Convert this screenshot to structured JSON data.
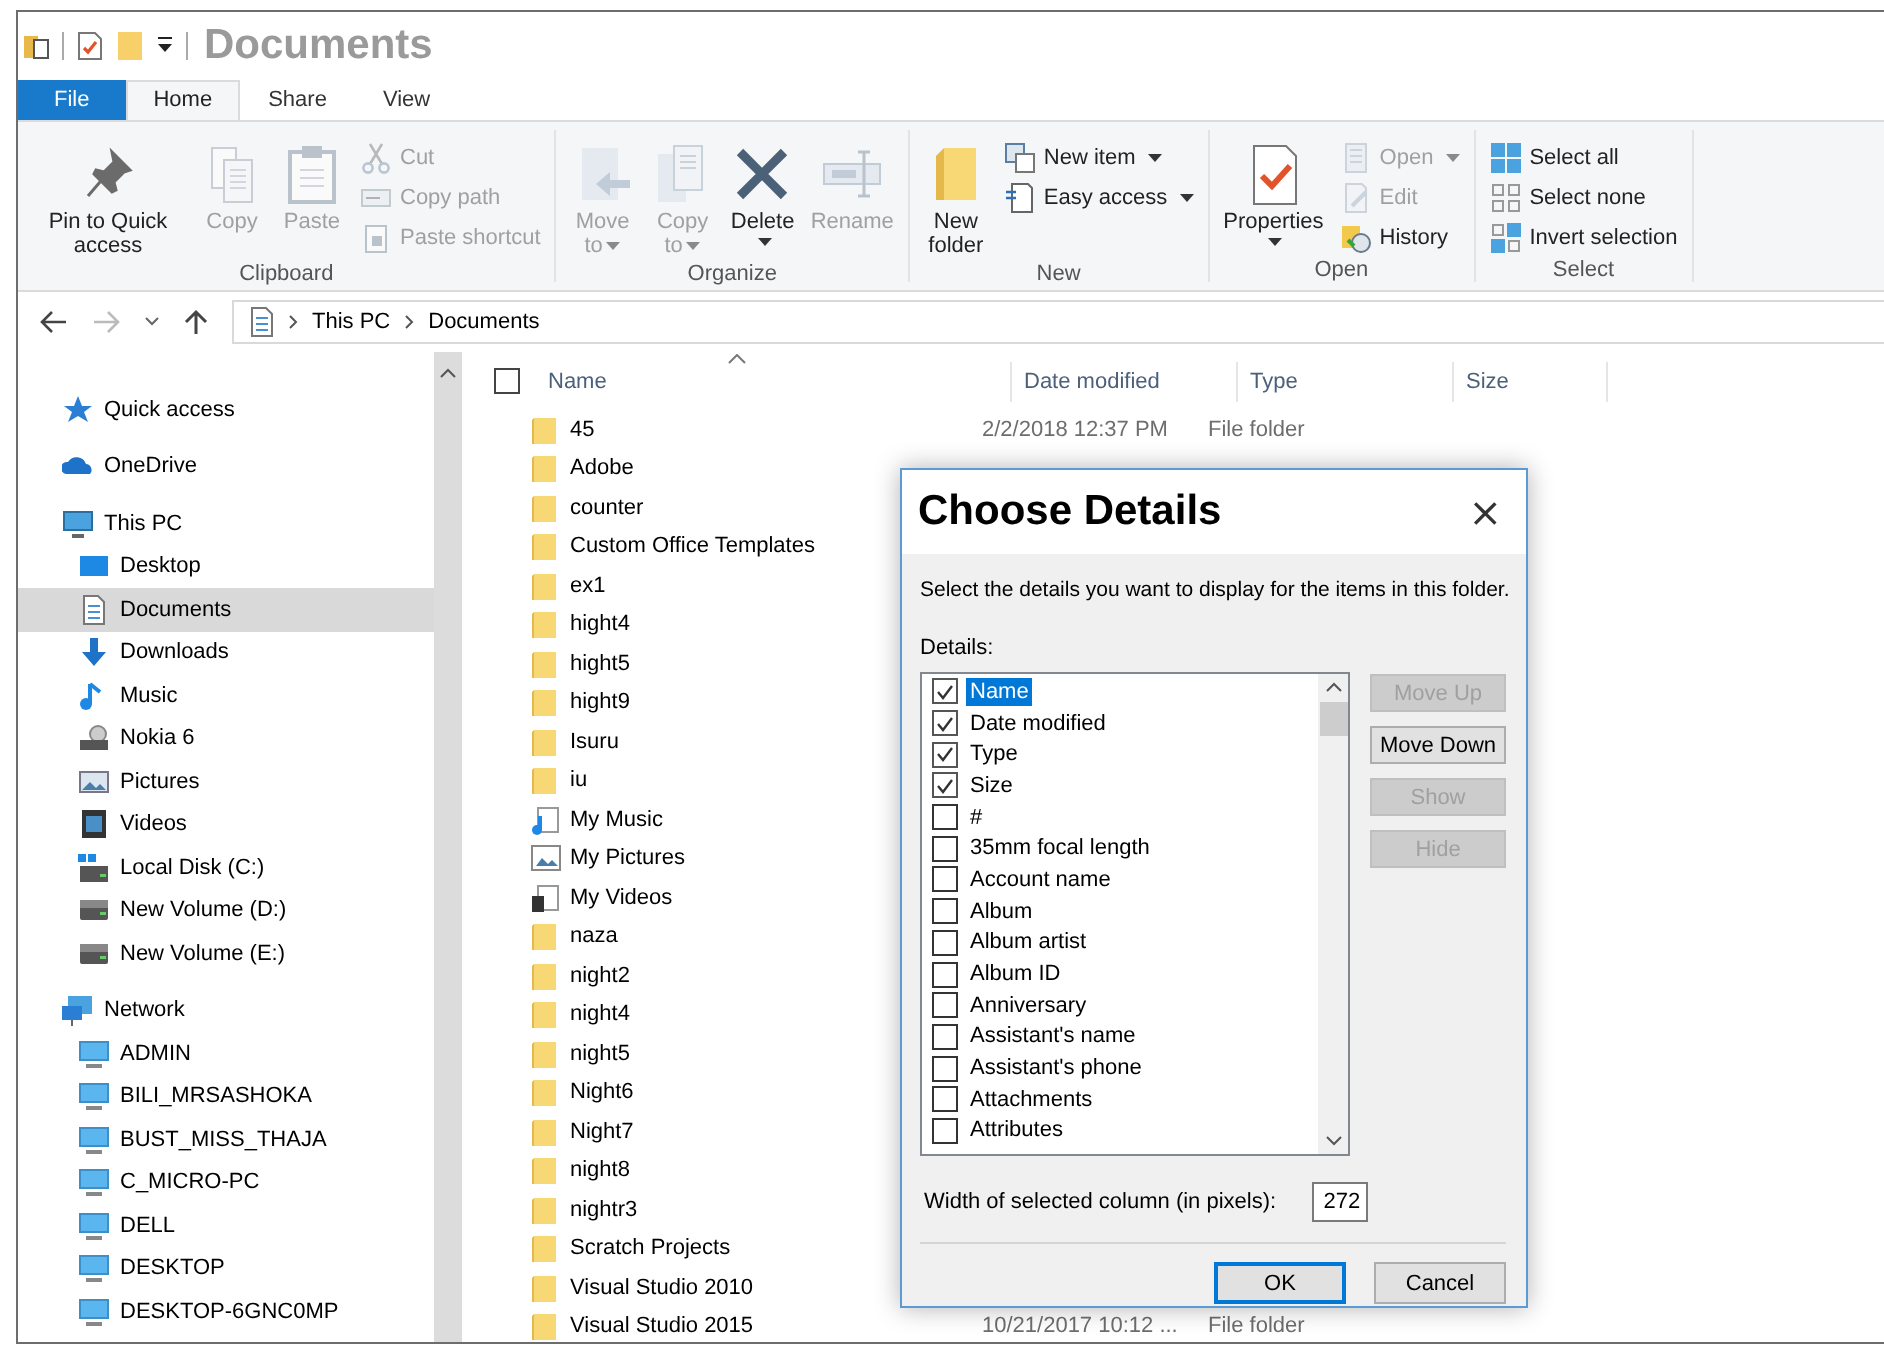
{
  "window": {
    "title": "Documents"
  },
  "ribbon_tabs": [
    {
      "label": "File",
      "kind": "file",
      "selected": false
    },
    {
      "label": "Home",
      "kind": "tab",
      "selected": true
    },
    {
      "label": "Share",
      "kind": "tab",
      "selected": false
    },
    {
      "label": "View",
      "kind": "tab",
      "selected": false
    }
  ],
  "ribbon_groups": [
    {
      "label": "Clipboard",
      "columns": [
        {
          "kind": "large",
          "label": "Pin to Quick access",
          "disabled": false
        },
        {
          "kind": "large",
          "label": "Copy",
          "disabled": true
        },
        {
          "kind": "large",
          "label": "Paste",
          "disabled": true
        },
        {
          "kind": "stack",
          "items": [
            {
              "label": "Cut",
              "disabled": true
            },
            {
              "label": "Copy path",
              "disabled": true
            },
            {
              "label": "Paste shortcut",
              "disabled": true
            }
          ]
        }
      ]
    },
    {
      "label": "Organize",
      "columns": [
        {
          "kind": "large",
          "label": "Move to",
          "disabled": true,
          "dropdown": true
        },
        {
          "kind": "large",
          "label": "Copy to",
          "disabled": true,
          "dropdown": true
        },
        {
          "kind": "split",
          "label": "Delete",
          "disabled": false
        },
        {
          "kind": "large",
          "label": "Rename",
          "disabled": true
        }
      ]
    },
    {
      "label": "New",
      "columns": [
        {
          "kind": "large",
          "label": "New folder",
          "disabled": false
        },
        {
          "kind": "stack",
          "items": [
            {
              "label": "New item",
              "disabled": false,
              "dropdown": true
            },
            {
              "label": "Easy access",
              "disabled": false,
              "dropdown": true
            }
          ]
        }
      ]
    },
    {
      "label": "Open",
      "columns": [
        {
          "kind": "split",
          "label": "Properties",
          "disabled": false
        },
        {
          "kind": "stack",
          "items": [
            {
              "label": "Open",
              "disabled": true,
              "dropdown": true
            },
            {
              "label": "Edit",
              "disabled": true
            },
            {
              "label": "History",
              "disabled": false
            }
          ]
        }
      ]
    },
    {
      "label": "Select",
      "columns": [
        {
          "kind": "stack",
          "items": [
            {
              "label": "Select all",
              "disabled": false
            },
            {
              "label": "Select none",
              "disabled": false
            },
            {
              "label": "Invert selection",
              "disabled": false
            }
          ]
        }
      ]
    }
  ],
  "address": {
    "path": [
      "This PC",
      "Documents"
    ]
  },
  "nav": {
    "items": [
      {
        "label": "Quick access",
        "kind": "star",
        "selected": false
      },
      {
        "label": "OneDrive",
        "kind": "cloud",
        "selected": false
      },
      {
        "label": "This PC",
        "kind": "pc",
        "selected": false,
        "children": [
          {
            "label": "Desktop",
            "kind": "desktop",
            "selected": false
          },
          {
            "label": "Documents",
            "kind": "documents",
            "selected": true
          },
          {
            "label": "Downloads",
            "kind": "downloads",
            "selected": false
          },
          {
            "label": "Music",
            "kind": "music",
            "selected": false
          },
          {
            "label": "Nokia 6",
            "kind": "device",
            "selected": false
          },
          {
            "label": "Pictures",
            "kind": "pictures",
            "selected": false
          },
          {
            "label": "Videos",
            "kind": "videos",
            "selected": false
          },
          {
            "label": "Local Disk (C:)",
            "kind": "system-disk",
            "selected": false
          },
          {
            "label": "New Volume (D:)",
            "kind": "disk",
            "selected": false
          },
          {
            "label": "New Volume (E:)",
            "kind": "disk",
            "selected": false
          }
        ]
      },
      {
        "label": "Network",
        "kind": "network",
        "selected": false,
        "children": [
          {
            "label": "ADMIN",
            "kind": "computer",
            "selected": false
          },
          {
            "label": "BILI_MRSASHOKA",
            "kind": "computer",
            "selected": false
          },
          {
            "label": "BUST_MISS_THAJA",
            "kind": "computer",
            "selected": false
          },
          {
            "label": "C_MICRO-PC",
            "kind": "computer",
            "selected": false
          },
          {
            "label": "DELL",
            "kind": "computer",
            "selected": false
          },
          {
            "label": "DESKTOP",
            "kind": "computer",
            "selected": false
          },
          {
            "label": "DESKTOP-6GNC0MP",
            "kind": "computer",
            "selected": false
          }
        ]
      }
    ]
  },
  "file_list": {
    "select_all_checked": false,
    "columns": [
      "Name",
      "Date modified",
      "Type",
      "Size"
    ],
    "rows": [
      {
        "name": "45",
        "kind": "folder",
        "selected": false,
        "date": "2/2/2018 12:37 PM",
        "type": "File folder"
      },
      {
        "name": "Adobe",
        "kind": "folder",
        "selected": false
      },
      {
        "name": "counter",
        "kind": "folder",
        "selected": false
      },
      {
        "name": "Custom Office Templates",
        "kind": "folder",
        "selected": false
      },
      {
        "name": "ex1",
        "kind": "folder",
        "selected": false
      },
      {
        "name": "hight4",
        "kind": "folder",
        "selected": false
      },
      {
        "name": "hight5",
        "kind": "folder",
        "selected": false
      },
      {
        "name": "hight9",
        "kind": "folder",
        "selected": false
      },
      {
        "name": "Isuru",
        "kind": "folder",
        "selected": false
      },
      {
        "name": "iu",
        "kind": "folder",
        "selected": false
      },
      {
        "name": "My Music",
        "kind": "music",
        "selected": false
      },
      {
        "name": "My Pictures",
        "kind": "pictures",
        "selected": false
      },
      {
        "name": "My Videos",
        "kind": "videos",
        "selected": false
      },
      {
        "name": "naza",
        "kind": "folder",
        "selected": false
      },
      {
        "name": "night2",
        "kind": "folder",
        "selected": false
      },
      {
        "name": "night4",
        "kind": "folder",
        "selected": false
      },
      {
        "name": "night5",
        "kind": "folder",
        "selected": false
      },
      {
        "name": "Night6",
        "kind": "folder",
        "selected": false
      },
      {
        "name": "Night7",
        "kind": "folder",
        "selected": false
      },
      {
        "name": "night8",
        "kind": "folder",
        "selected": false
      },
      {
        "name": "nightr3",
        "kind": "folder",
        "selected": false
      },
      {
        "name": "Scratch Projects",
        "kind": "folder",
        "selected": false
      },
      {
        "name": "Visual Studio 2010",
        "kind": "folder",
        "selected": false
      },
      {
        "name": "Visual Studio 2015",
        "kind": "folder",
        "selected": false,
        "date": "10/21/2017 10:12 ...",
        "type": "File folder"
      }
    ]
  },
  "dialog": {
    "title": "Choose Details",
    "close": "×",
    "description": "Select the details you want to display for the items in this folder.",
    "list_label": "Details:",
    "details": [
      {
        "label": "Name",
        "checked": true,
        "selected": true
      },
      {
        "label": "Date modified",
        "checked": true,
        "selected": false
      },
      {
        "label": "Type",
        "checked": true,
        "selected": false
      },
      {
        "label": "Size",
        "checked": true,
        "selected": false
      },
      {
        "label": "#",
        "checked": false,
        "selected": false
      },
      {
        "label": "35mm focal length",
        "checked": false,
        "selected": false
      },
      {
        "label": "Account name",
        "checked": false,
        "selected": false
      },
      {
        "label": "Album",
        "checked": false,
        "selected": false
      },
      {
        "label": "Album artist",
        "checked": false,
        "selected": false
      },
      {
        "label": "Album ID",
        "checked": false,
        "selected": false
      },
      {
        "label": "Anniversary",
        "checked": false,
        "selected": false
      },
      {
        "label": "Assistant's name",
        "checked": false,
        "selected": false
      },
      {
        "label": "Assistant's phone",
        "checked": false,
        "selected": false
      },
      {
        "label": "Attachments",
        "checked": false,
        "selected": false
      },
      {
        "label": "Attributes",
        "checked": false,
        "selected": false
      }
    ],
    "side_buttons": [
      {
        "label": "Move Up",
        "disabled": true
      },
      {
        "label": "Move Down",
        "disabled": false
      },
      {
        "label": "Show",
        "disabled": true
      },
      {
        "label": "Hide",
        "disabled": true
      }
    ],
    "width_label": "Width of selected column (in pixels):",
    "width_value": "272",
    "buttons": [
      {
        "label": "OK",
        "default": true
      },
      {
        "label": "Cancel",
        "default": false
      }
    ]
  }
}
